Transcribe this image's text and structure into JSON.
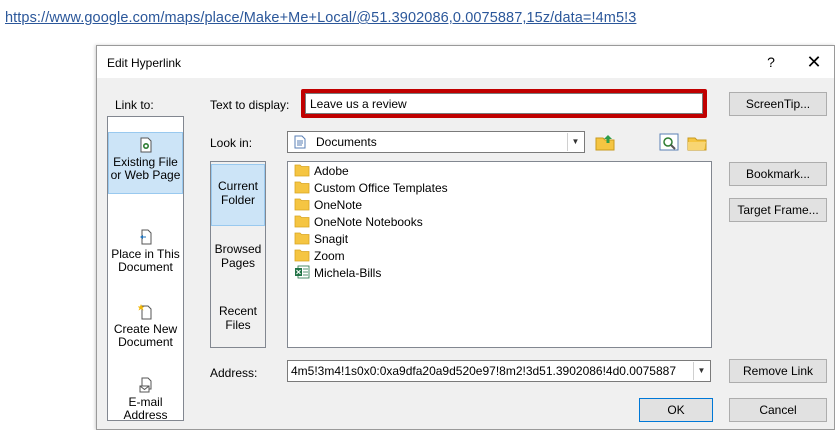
{
  "document": {
    "link_line1": "https://www.google.com/maps/place/Make+Me+Local/@51.3902086,0.0075887,15z/data=!4m5!3",
    "link_line2": ""
  },
  "dialog": {
    "title": "Edit Hyperlink",
    "help": "?",
    "close": "✕",
    "link_to_label": "Link to:",
    "text_to_display_label": "Text to display:",
    "text_to_display_value": "Leave us a review",
    "screentip_button": "ScreenTip...",
    "look_in_label": "Look in:",
    "look_in_value": "Documents",
    "bookmark_button": "Bookmark...",
    "target_frame_button": "Target Frame...",
    "address_label": "Address:",
    "address_value": "4m5!3m4!1s0x0:0xa9dfa20a9d520e97!8m2!3d51.3902086!4d0.0075887",
    "remove_link_button": "Remove Link",
    "ok_button": "OK",
    "cancel_button": "Cancel"
  },
  "link_to_items": [
    {
      "label_a": "Existing File",
      "label_b": "or Web Page",
      "icon": "existing-file-icon",
      "selected": true
    },
    {
      "label_a": "Place in This",
      "label_b": "Document",
      "icon": "place-in-document-icon",
      "selected": false
    },
    {
      "label_a": "Create New",
      "label_b": "Document",
      "icon": "create-new-document-icon",
      "selected": false
    },
    {
      "label_a": "E-mail",
      "label_b": "Address",
      "icon": "email-address-icon",
      "selected": false
    }
  ],
  "side_tabs": [
    {
      "label_a": "Current",
      "label_b": "Folder",
      "selected": true
    },
    {
      "label_a": "Browsed",
      "label_b": "Pages",
      "selected": false
    },
    {
      "label_a": "Recent",
      "label_b": "Files",
      "selected": false
    }
  ],
  "files": [
    {
      "name": "Adobe",
      "icon": "folder-icon"
    },
    {
      "name": "Custom Office Templates",
      "icon": "folder-icon"
    },
    {
      "name": "OneNote",
      "icon": "folder-icon"
    },
    {
      "name": "OneNote Notebooks",
      "icon": "folder-icon"
    },
    {
      "name": "Snagit",
      "icon": "folder-icon"
    },
    {
      "name": "Zoom",
      "icon": "folder-icon"
    },
    {
      "name": "Michela-Bills",
      "icon": "excel-file-icon"
    }
  ],
  "colors": {
    "link": "#2b579a",
    "highlight_outline": "#c00000",
    "selection": "#cce4f7",
    "folder": "#f5c542"
  }
}
